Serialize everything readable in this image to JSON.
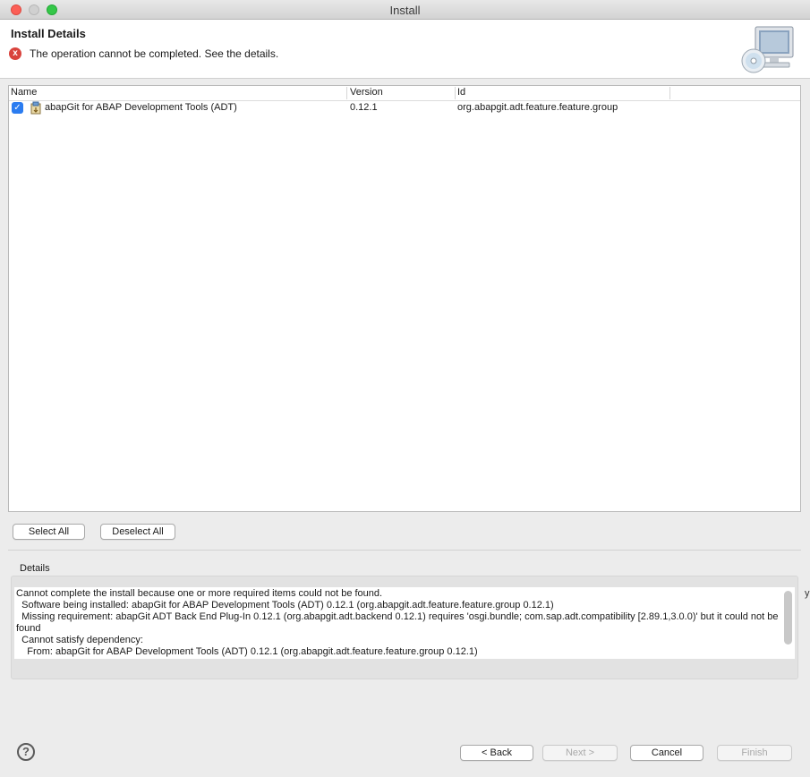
{
  "window": {
    "title": "Install"
  },
  "header": {
    "title": "Install Details",
    "error_glyph": "x",
    "message": "The operation cannot be completed.  See the details."
  },
  "table": {
    "columns": [
      "Name",
      "Version",
      "Id"
    ],
    "rows": [
      {
        "checked": true,
        "name": "abapGit for ABAP Development Tools (ADT)",
        "version": "0.12.1",
        "id": "org.abapgit.adt.feature.feature.group"
      }
    ]
  },
  "selection": {
    "select_all": "Select All",
    "deselect_all": "Deselect All"
  },
  "details": {
    "label": "Details",
    "text": "Cannot complete the install because one or more required items could not be found.\n  Software being installed: abapGit for ABAP Development Tools (ADT) 0.12.1 (org.abapgit.adt.feature.feature.group 0.12.1)\n  Missing requirement: abapGit ADT Back End Plug-In 0.12.1 (org.abapgit.adt.backend 0.12.1) requires 'osgi.bundle; com.sap.adt.compatibility [2.89.1,3.0.0)' but it could not be found\n  Cannot satisfy dependency:\n    From: abapGit for ABAP Development Tools (ADT) 0.12.1 (org.abapgit.adt.feature.feature.group 0.12.1)"
  },
  "footer": {
    "help_glyph": "?",
    "back": "< Back",
    "next": "Next >",
    "cancel": "Cancel",
    "finish": "Finish"
  },
  "edge_text": "y",
  "colors": {
    "error": "#d9433d",
    "checkbox": "#2b7cf0",
    "close": "#fc5f57",
    "maximize": "#34c748"
  },
  "icons": [
    "close-window-icon",
    "minimize-window-icon",
    "maximize-window-icon",
    "error-icon",
    "install-monitor-icon",
    "checkbox-checked-icon",
    "feature-plugin-icon",
    "help-icon"
  ]
}
